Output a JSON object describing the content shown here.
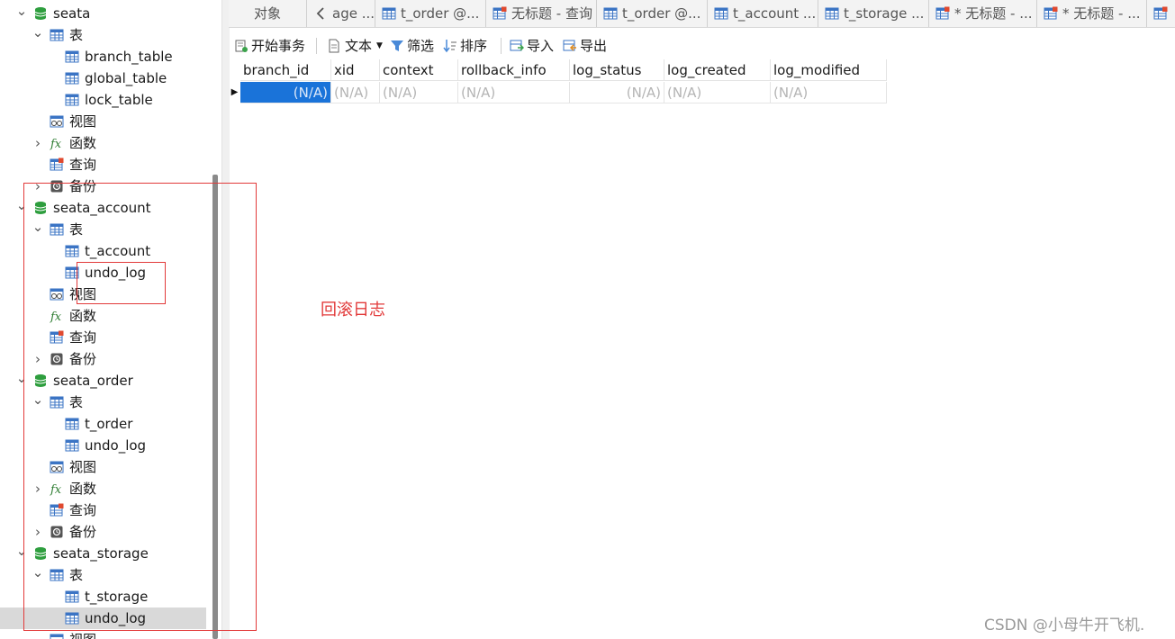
{
  "sidebar": {
    "items": [
      {
        "label": "seata",
        "icon": "database-icon",
        "expanded": true,
        "depth": 0,
        "type": "database"
      },
      {
        "label": "表",
        "icon": "table-icon",
        "expanded": true,
        "depth": 1,
        "type": "folder-tables"
      },
      {
        "label": "branch_table",
        "icon": "table-icon",
        "depth": 2,
        "type": "table"
      },
      {
        "label": "global_table",
        "icon": "table-icon",
        "depth": 2,
        "type": "table"
      },
      {
        "label": "lock_table",
        "icon": "table-icon",
        "depth": 2,
        "type": "table"
      },
      {
        "label": "视图",
        "icon": "view-icon",
        "depth": 1,
        "type": "folder-views"
      },
      {
        "label": "函数",
        "icon": "function-icon",
        "expanded": false,
        "depth": 1,
        "type": "folder-functions"
      },
      {
        "label": "查询",
        "icon": "query-icon",
        "depth": 1,
        "type": "folder-queries"
      },
      {
        "label": "备份",
        "icon": "backup-icon",
        "expanded": false,
        "depth": 1,
        "type": "folder-backups"
      },
      {
        "label": "seata_account",
        "icon": "database-icon",
        "expanded": true,
        "depth": 0,
        "type": "database"
      },
      {
        "label": "表",
        "icon": "table-icon",
        "expanded": true,
        "depth": 1,
        "type": "folder-tables"
      },
      {
        "label": "t_account",
        "icon": "table-icon",
        "depth": 2,
        "type": "table"
      },
      {
        "label": "undo_log",
        "icon": "table-icon",
        "depth": 2,
        "type": "table"
      },
      {
        "label": "视图",
        "icon": "view-icon",
        "depth": 1,
        "type": "folder-views"
      },
      {
        "label": "函数",
        "icon": "function-icon",
        "depth": 1,
        "type": "folder-functions"
      },
      {
        "label": "查询",
        "icon": "query-icon",
        "depth": 1,
        "type": "folder-queries"
      },
      {
        "label": "备份",
        "icon": "backup-icon",
        "expanded": false,
        "depth": 1,
        "type": "folder-backups"
      },
      {
        "label": "seata_order",
        "icon": "database-icon",
        "expanded": true,
        "depth": 0,
        "type": "database"
      },
      {
        "label": "表",
        "icon": "table-icon",
        "expanded": true,
        "depth": 1,
        "type": "folder-tables"
      },
      {
        "label": "t_order",
        "icon": "table-icon",
        "depth": 2,
        "type": "table"
      },
      {
        "label": "undo_log",
        "icon": "table-icon",
        "depth": 2,
        "type": "table"
      },
      {
        "label": "视图",
        "icon": "view-icon",
        "depth": 1,
        "type": "folder-views"
      },
      {
        "label": "函数",
        "icon": "function-icon",
        "expanded": false,
        "depth": 1,
        "type": "folder-functions"
      },
      {
        "label": "查询",
        "icon": "query-icon",
        "depth": 1,
        "type": "folder-queries"
      },
      {
        "label": "备份",
        "icon": "backup-icon",
        "expanded": false,
        "depth": 1,
        "type": "folder-backups"
      },
      {
        "label": "seata_storage",
        "icon": "database-icon",
        "expanded": true,
        "depth": 0,
        "type": "database"
      },
      {
        "label": "表",
        "icon": "table-icon",
        "expanded": true,
        "depth": 1,
        "type": "folder-tables"
      },
      {
        "label": "t_storage",
        "icon": "table-icon",
        "depth": 2,
        "type": "table"
      },
      {
        "label": "undo_log",
        "icon": "table-icon",
        "depth": 2,
        "type": "table",
        "selected": true
      },
      {
        "label": "视图",
        "icon": "view-icon",
        "depth": 1,
        "type": "folder-views"
      }
    ]
  },
  "tabs": [
    {
      "label": "对象",
      "icon": null
    },
    {
      "label": "age ...",
      "icon": "back-chevron-icon"
    },
    {
      "label": "t_order @...",
      "icon": "table-icon"
    },
    {
      "label": "无标题 - 查询",
      "icon": "query-icon"
    },
    {
      "label": "t_order @...",
      "icon": "table-icon"
    },
    {
      "label": "t_account ...",
      "icon": "table-icon"
    },
    {
      "label": "t_storage ...",
      "icon": "table-icon"
    },
    {
      "label": "* 无标题 - ...",
      "icon": "query-icon"
    },
    {
      "label": "* 无标题 - ...",
      "icon": "query-icon"
    },
    {
      "label": "",
      "icon": "query-icon"
    }
  ],
  "toolbar": {
    "begin_transaction": "开始事务",
    "text": "文本",
    "filter": "筛选",
    "sort": "排序",
    "import": "导入",
    "export": "导出"
  },
  "grid": {
    "columns": [
      "branch_id",
      "xid",
      "context",
      "rollback_info",
      "log_status",
      "log_created",
      "log_modified"
    ],
    "rows": [
      [
        "(N/A)",
        "(N/A)",
        "(N/A)",
        "(N/A)",
        "(N/A)",
        "(N/A)",
        "(N/A)"
      ]
    ]
  },
  "annotation": {
    "label": "回滚日志",
    "color": "#e23a3a"
  },
  "watermark": "CSDN @小母牛开飞机.",
  "colors": {
    "selection": "#1a73d9",
    "database_icon": "#2e9e3e",
    "table_icon": "#3b74c4",
    "annotation_red": "#e23a3a"
  }
}
